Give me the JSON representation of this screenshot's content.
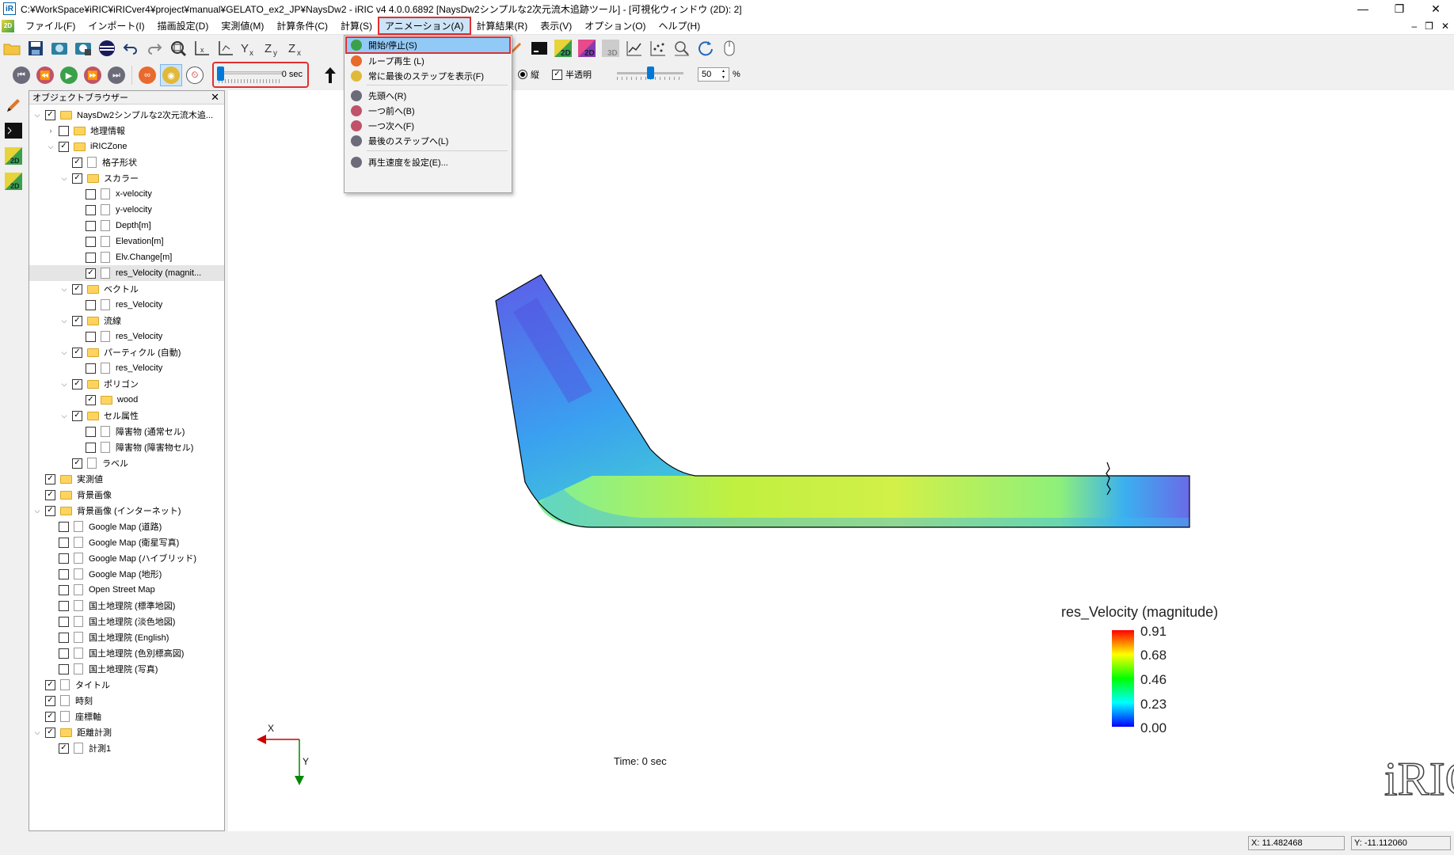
{
  "titlebar": {
    "app_icon_label": "iR",
    "title": "C:¥WorkSpace¥iRIC¥iRICver4¥project¥manual¥GELATO_ex2_JP¥NaysDw2 - iRIC v4 4.0.0.6892 [NaysDw2シンプルな2次元流木追跡ツール] - [可視化ウィンドウ (2D): 2]",
    "minimize": "—",
    "restore": "❐",
    "close": "✕"
  },
  "menubar": {
    "mdi_icon_label": "2D",
    "items": [
      "ファイル(F)",
      "インポート(I)",
      "描画設定(D)",
      "実測値(M)",
      "計算条件(C)",
      "計算(S)",
      "アニメーション(A)",
      "計算結果(R)",
      "表示(V)",
      "オプション(O)",
      "ヘルプ(H)"
    ],
    "mdi_min": "–",
    "mdi_restore": "❐",
    "mdi_close": "✕"
  },
  "toolbar1": {
    "icons": [
      "open-folder-icon",
      "save-icon",
      "snapshot-icon",
      "continuous-snapshot-icon",
      "google-earth-icon",
      "undo-icon",
      "redo-icon",
      "zoom-fit-icon",
      "axis-x-icon",
      "axis-xy-icon",
      "yx-view-icon",
      "zy-view-icon",
      "zx-view-icon",
      "run-icon",
      "stop-icon",
      "pencil-icon",
      "console-icon",
      "new-2d-window-icon",
      "new-2d-bird-icon",
      "new-3d-window-icon",
      "graph-icon",
      "scatter-graph-icon",
      "zoom-window-icon",
      "refresh-icon",
      "mouse-help-icon"
    ]
  },
  "toolbar2": {
    "slider_value": "0 sec",
    "slider_fraction": 0.0,
    "vertical_label": "縦",
    "transparent_label": "半透明",
    "transparency_value": "50",
    "percent": "%"
  },
  "animation_menu": {
    "items": [
      {
        "label": "開始/停止(S)",
        "icon": "play-icon",
        "color": "#3aa14a",
        "highlighted": true
      },
      {
        "label": "ループ再生 (L)",
        "icon": "loop-icon",
        "color": "#e86a2c"
      },
      {
        "label": "常に最後のステップを表示(F)",
        "icon": "eye-icon",
        "color": "#e0b93a"
      },
      {
        "label": "先頭へ(R)",
        "icon": "first-step-icon",
        "color": "#6b6b7a"
      },
      {
        "label": "一つ前へ(B)",
        "icon": "previous-step-icon",
        "color": "#c0526a"
      },
      {
        "label": "一つ次へ(F)",
        "icon": "next-step-icon",
        "color": "#c0526a"
      },
      {
        "label": "最後のステップへ(L)",
        "icon": "last-step-icon",
        "color": "#6b6b7a"
      },
      {
        "label": "再生速度を設定(E)...",
        "icon": "clock-icon",
        "color": "#6b6b7a"
      }
    ]
  },
  "object_browser": {
    "title": "オブジェクトブラウザー",
    "close": "✕",
    "tree": [
      {
        "label": "NaysDw2シンプルな2次元流木追...",
        "level": 0,
        "expander": "v",
        "checked": true,
        "kind": "folder"
      },
      {
        "label": "地理情報",
        "level": 1,
        "expander": ">",
        "checked": false,
        "kind": "folder"
      },
      {
        "label": "iRICZone",
        "level": 1,
        "expander": "v",
        "checked": true,
        "kind": "folder"
      },
      {
        "label": "格子形状",
        "level": 2,
        "expander": "",
        "checked": true,
        "kind": "file"
      },
      {
        "label": "スカラー",
        "level": 2,
        "expander": "v",
        "checked": true,
        "kind": "folder"
      },
      {
        "label": "x-velocity",
        "level": 3,
        "expander": "",
        "checked": false,
        "kind": "file"
      },
      {
        "label": "y-velocity",
        "level": 3,
        "expander": "",
        "checked": false,
        "kind": "file"
      },
      {
        "label": "Depth[m]",
        "level": 3,
        "expander": "",
        "checked": false,
        "kind": "file"
      },
      {
        "label": "Elevation[m]",
        "level": 3,
        "expander": "",
        "checked": false,
        "kind": "file"
      },
      {
        "label": "Elv.Change[m]",
        "level": 3,
        "expander": "",
        "checked": false,
        "kind": "file"
      },
      {
        "label": "res_Velocity (magnit...",
        "level": 3,
        "expander": "",
        "checked": true,
        "kind": "file",
        "selected": true
      },
      {
        "label": "ベクトル",
        "level": 2,
        "expander": "v",
        "checked": true,
        "kind": "folder"
      },
      {
        "label": "res_Velocity",
        "level": 3,
        "expander": "",
        "checked": false,
        "kind": "file"
      },
      {
        "label": "流線",
        "level": 2,
        "expander": "v",
        "checked": true,
        "kind": "folder"
      },
      {
        "label": "res_Velocity",
        "level": 3,
        "expander": "",
        "checked": false,
        "kind": "file"
      },
      {
        "label": "パーティクル (自動)",
        "level": 2,
        "expander": "v",
        "checked": true,
        "kind": "folder"
      },
      {
        "label": "res_Velocity",
        "level": 3,
        "expander": "",
        "checked": false,
        "kind": "file"
      },
      {
        "label": "ポリゴン",
        "level": 2,
        "expander": "v",
        "checked": true,
        "kind": "folder"
      },
      {
        "label": "wood",
        "level": 3,
        "expander": "",
        "checked": true,
        "kind": "folder"
      },
      {
        "label": "セル属性",
        "level": 2,
        "expander": "v",
        "checked": true,
        "kind": "folder"
      },
      {
        "label": "障害物 (通常セル)",
        "level": 3,
        "expander": "",
        "checked": false,
        "kind": "file"
      },
      {
        "label": "障害物 (障害物セル)",
        "level": 3,
        "expander": "",
        "checked": false,
        "kind": "file"
      },
      {
        "label": "ラベル",
        "level": 2,
        "expander": "",
        "checked": true,
        "kind": "file"
      },
      {
        "label": "実測値",
        "level": 0,
        "expander": "",
        "checked": true,
        "kind": "folder"
      },
      {
        "label": "背景画像",
        "level": 0,
        "expander": "",
        "checked": true,
        "kind": "folder"
      },
      {
        "label": "背景画像 (インターネット)",
        "level": 0,
        "expander": "v",
        "checked": true,
        "kind": "folder"
      },
      {
        "label": "Google Map (道路)",
        "level": 1,
        "expander": "",
        "checked": false,
        "kind": "file"
      },
      {
        "label": "Google Map (衛星写真)",
        "level": 1,
        "expander": "",
        "checked": false,
        "kind": "file"
      },
      {
        "label": "Google Map (ハイブリッド)",
        "level": 1,
        "expander": "",
        "checked": false,
        "kind": "file"
      },
      {
        "label": "Google Map (地形)",
        "level": 1,
        "expander": "",
        "checked": false,
        "kind": "file"
      },
      {
        "label": "Open Street Map",
        "level": 1,
        "expander": "",
        "checked": false,
        "kind": "file"
      },
      {
        "label": "国土地理院 (標準地図)",
        "level": 1,
        "expander": "",
        "checked": false,
        "kind": "file"
      },
      {
        "label": "国土地理院 (淡色地図)",
        "level": 1,
        "expander": "",
        "checked": false,
        "kind": "file"
      },
      {
        "label": "国土地理院 (English)",
        "level": 1,
        "expander": "",
        "checked": false,
        "kind": "file"
      },
      {
        "label": "国土地理院 (色別標高図)",
        "level": 1,
        "expander": "",
        "checked": false,
        "kind": "file"
      },
      {
        "label": "国土地理院 (写真)",
        "level": 1,
        "expander": "",
        "checked": false,
        "kind": "file"
      },
      {
        "label": "タイトル",
        "level": 0,
        "expander": "",
        "checked": true,
        "kind": "file"
      },
      {
        "label": "時刻",
        "level": 0,
        "expander": "",
        "checked": true,
        "kind": "file"
      },
      {
        "label": "座標軸",
        "level": 0,
        "expander": "",
        "checked": true,
        "kind": "file"
      },
      {
        "label": "距離計測",
        "level": 0,
        "expander": "v",
        "checked": true,
        "kind": "folder"
      },
      {
        "label": "計測1",
        "level": 1,
        "expander": "",
        "checked": true,
        "kind": "file"
      }
    ]
  },
  "viewport": {
    "legend_title": "res_Velocity (magnitude)",
    "legend_ticks": [
      "0.91",
      "0.68",
      "0.46",
      "0.23",
      "0.00"
    ],
    "time_label": "Time: 0 sec",
    "axis_x": "X",
    "axis_y": "Y",
    "logo": "iRIC"
  },
  "statusbar": {
    "x": "X: 11.482468",
    "y": "Y: -11.112060"
  }
}
